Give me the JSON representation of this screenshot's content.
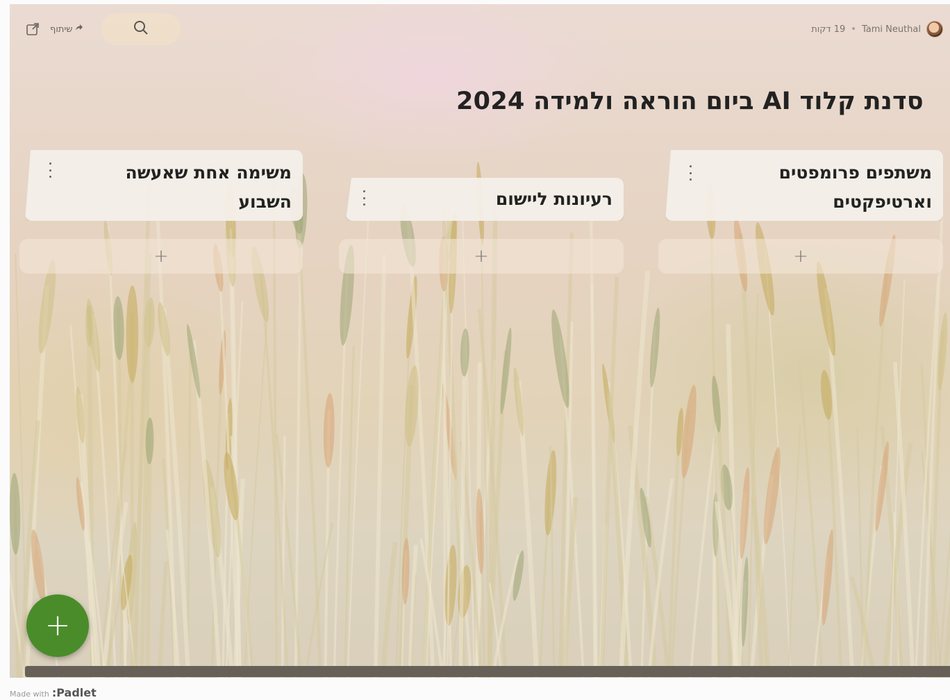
{
  "header": {
    "share_label": "שיתוף",
    "share_icon": "share-arrow-icon",
    "external_icon": "external-link-icon",
    "search_icon": "search-icon",
    "author": "Tami Neuthal",
    "separator": "•",
    "time_ago": "19 דקות"
  },
  "board": {
    "title": "סדנת קלוד AI ביום הוראה ולמידה 2024",
    "columns": [
      {
        "title": "משתפים פרומפטים וארטיפקטים",
        "add_label": "+"
      },
      {
        "title": "רעיונות ליישום",
        "add_label": "+"
      },
      {
        "title": "משימה אחת שאעשה השבוע",
        "add_label": "+"
      }
    ]
  },
  "fab": {
    "label": "+"
  },
  "footer": {
    "made_with": "Made with",
    "brand": ":Padlet"
  },
  "colors": {
    "fab": "#4a8c2a",
    "column_bg": "#f4eee8",
    "scrollbar": "#676058"
  }
}
